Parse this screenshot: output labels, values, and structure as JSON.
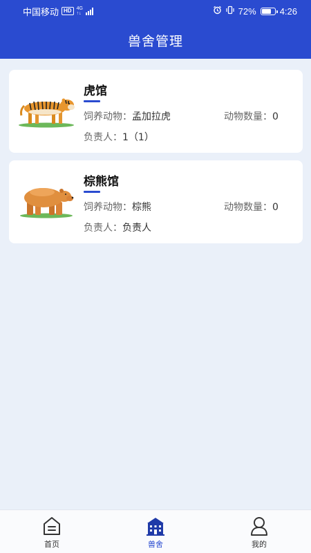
{
  "status_bar": {
    "carrier": "中国移动",
    "hd": "HD",
    "net": "4G",
    "battery_percent": "72%",
    "battery_level": 0.72,
    "time": "4:26"
  },
  "header": {
    "title": "兽舍管理"
  },
  "labels": {
    "feed": "饲养动物：",
    "count": "动物数量：",
    "owner": "负责人："
  },
  "cards": [
    {
      "name": "虎馆",
      "animal": "孟加拉虎",
      "count": "0",
      "owner": "1（1）",
      "icon": "tiger-image"
    },
    {
      "name": "棕熊馆",
      "animal": "棕熊",
      "count": "0",
      "owner": "负责人",
      "icon": "bear-image"
    }
  ],
  "nav": [
    {
      "label": "首页",
      "icon": "home-icon",
      "active": false
    },
    {
      "label": "兽舍",
      "icon": "building-icon",
      "active": true
    },
    {
      "label": "我的",
      "icon": "user-icon",
      "active": false
    }
  ],
  "colors": {
    "primary": "#2a4bd0",
    "background": "#eaf0f9"
  }
}
